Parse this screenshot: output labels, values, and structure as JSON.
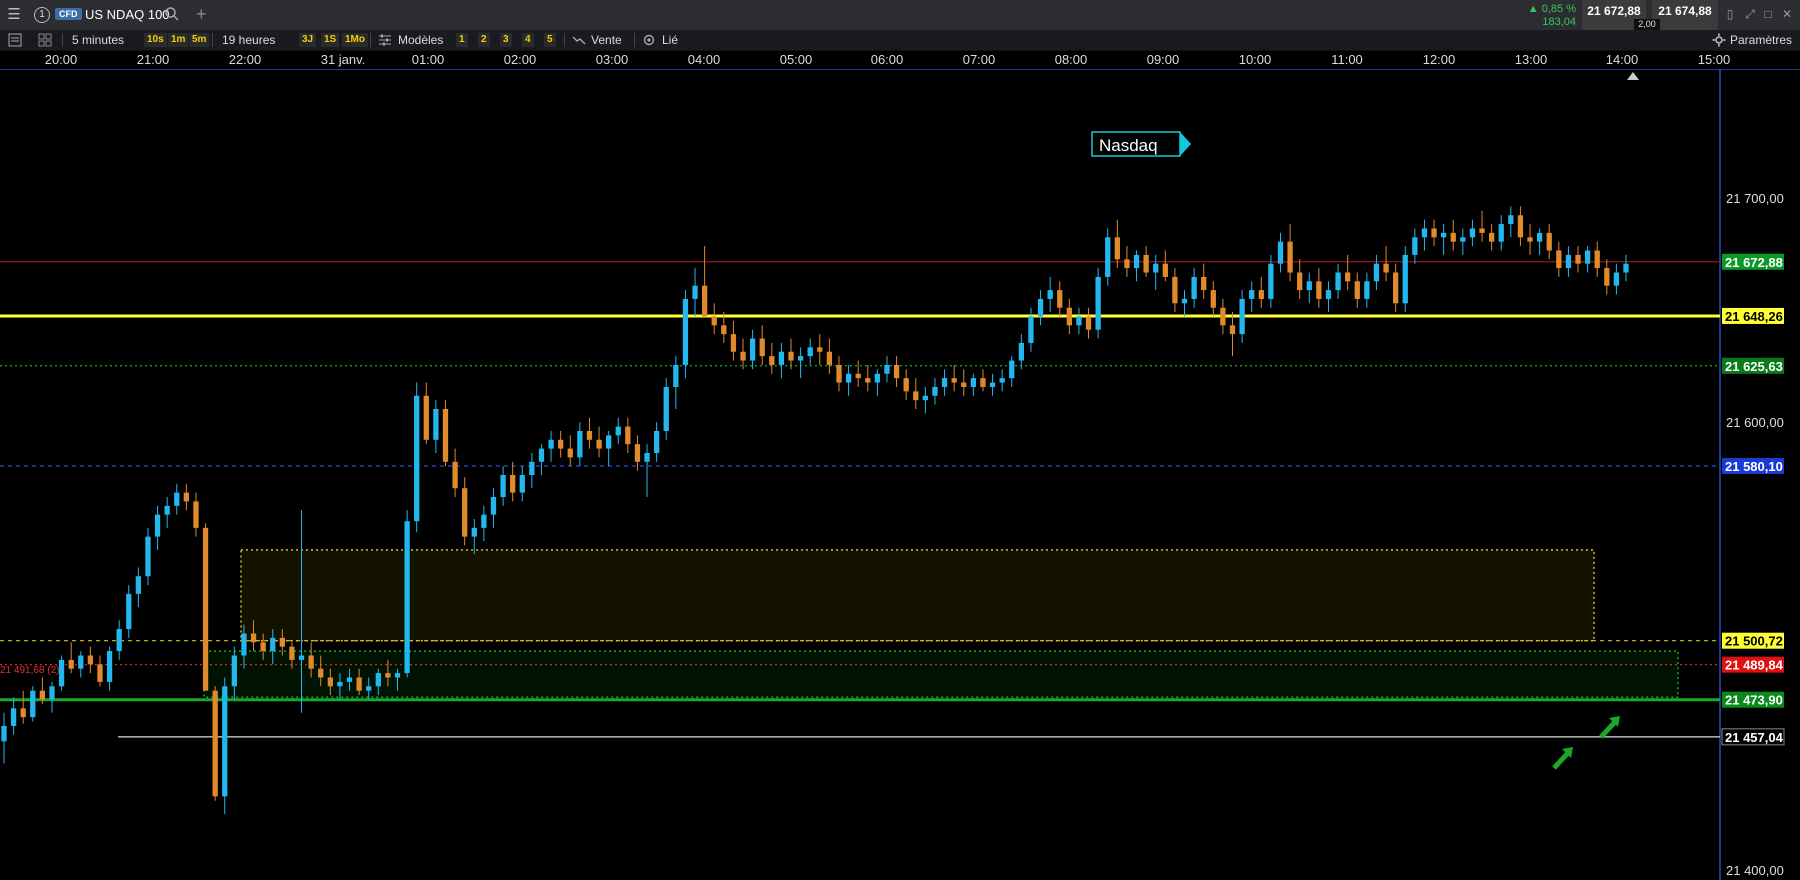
{
  "titlebar": {
    "window_number": "1",
    "instrument_type": "CFD",
    "symbol": "US NDAQ 100",
    "change_pct": "▲ 0,85 %",
    "change_abs": "183,04",
    "bid": "21 672,88",
    "spread": "2,00",
    "ask": "21 674,88"
  },
  "toolbar": {
    "interval": "5 minutes",
    "quick_intervals": [
      "10s",
      "1m",
      "5m"
    ],
    "range": "19 heures",
    "quick_ranges": [
      "3J",
      "1S",
      "1Mo"
    ],
    "models_label": "Modèles",
    "models": [
      "1",
      "2",
      "3",
      "4",
      "5"
    ],
    "sell_label": "Vente",
    "linked_label": "Lié",
    "settings_label": "Paramètres"
  },
  "time_axis": [
    "20:00",
    "21:00",
    "22:00",
    "31 janv.",
    "01:00",
    "02:00",
    "03:00",
    "04:00",
    "05:00",
    "06:00",
    "07:00",
    "08:00",
    "09:00",
    "10:00",
    "11:00",
    "12:00",
    "13:00",
    "14:00",
    "15:00"
  ],
  "annotation": {
    "text": "Nasdaq"
  },
  "price_axis": [
    "21 700,00",
    "21 600,00",
    "21 400,00"
  ],
  "levels": [
    {
      "label": "21 672,88",
      "value": 21672.88,
      "color": "#8b1a1a",
      "badge_bg": "#0a9a2a",
      "badge_fg": "#ffffff",
      "style": "solid"
    },
    {
      "label": "21 648,26",
      "value": 21648.26,
      "color": "#ffff33",
      "badge_bg": "#ffff33",
      "badge_fg": "#000000",
      "style": "solid-thick"
    },
    {
      "label": "21 625,63",
      "value": 21625.63,
      "color": "#1aaa2a",
      "badge_bg": "#0a7a1a",
      "badge_fg": "#ffffff",
      "style": "dotted"
    },
    {
      "label": "21 580,10",
      "value": 21580.1,
      "color": "#2a4ad8",
      "badge_bg": "#1a3ad8",
      "badge_fg": "#ffffff",
      "style": "dashed"
    },
    {
      "label": "21 500,72",
      "value": 21500.72,
      "color": "#d8c020",
      "badge_bg": "#ffff33",
      "badge_fg": "#000000",
      "style": "dashed"
    },
    {
      "label": "21 489,84",
      "value": 21489.84,
      "color": "#e02020",
      "badge_bg": "#e01010",
      "badge_fg": "#ffffff",
      "style": "dotted"
    },
    {
      "label": "21 473,90",
      "value": 21473.9,
      "color": "#1aa82a",
      "badge_bg": "#0a8a1a",
      "badge_fg": "#ffffff",
      "style": "solid-thick"
    },
    {
      "label": "21 457,04",
      "value": 21457.04,
      "color": "#dddddd",
      "badge_bg": "#000000",
      "badge_fg": "#ffffff",
      "style": "solid"
    }
  ],
  "left_clipped_label": "21 491,68 (2)",
  "chart_data": {
    "type": "candlestick",
    "x_ticks": [
      "20:00",
      "21:00",
      "22:00",
      "31 janv.",
      "01:00",
      "02:00",
      "03:00",
      "04:00",
      "05:00",
      "06:00",
      "07:00",
      "08:00",
      "09:00",
      "10:00",
      "11:00",
      "12:00",
      "13:00",
      "14:00",
      "15:00"
    ],
    "y_ticks": [
      21700,
      21600,
      21400
    ],
    "ylim": [
      21392,
      21760
    ],
    "colors": {
      "up": "#22b8ee",
      "down": "#e08a2c"
    },
    "candles": [
      [
        21455,
        21468,
        21445,
        21462
      ],
      [
        21462,
        21475,
        21458,
        21470
      ],
      [
        21470,
        21478,
        21463,
        21466
      ],
      [
        21466,
        21480,
        21464,
        21478
      ],
      [
        21478,
        21484,
        21472,
        21474
      ],
      [
        21474,
        21482,
        21468,
        21480
      ],
      [
        21480,
        21494,
        21478,
        21492
      ],
      [
        21492,
        21500,
        21486,
        21488
      ],
      [
        21488,
        21496,
        21484,
        21494
      ],
      [
        21494,
        21498,
        21486,
        21490
      ],
      [
        21490,
        21494,
        21480,
        21482
      ],
      [
        21482,
        21498,
        21478,
        21496
      ],
      [
        21496,
        21510,
        21492,
        21506
      ],
      [
        21506,
        21526,
        21502,
        21522
      ],
      [
        21522,
        21534,
        21516,
        21530
      ],
      [
        21530,
        21552,
        21526,
        21548
      ],
      [
        21548,
        21562,
        21542,
        21558
      ],
      [
        21558,
        21566,
        21552,
        21562
      ],
      [
        21562,
        21572,
        21558,
        21568
      ],
      [
        21568,
        21572,
        21560,
        21564
      ],
      [
        21564,
        21568,
        21548,
        21552
      ],
      [
        21552,
        21554,
        21480,
        21478
      ],
      [
        21478,
        21480,
        21428,
        21430
      ],
      [
        21430,
        21484,
        21422,
        21480
      ],
      [
        21480,
        21498,
        21474,
        21494
      ],
      [
        21494,
        21508,
        21488,
        21504
      ],
      [
        21504,
        21510,
        21496,
        21500
      ],
      [
        21500,
        21504,
        21492,
        21496
      ],
      [
        21496,
        21506,
        21490,
        21502
      ],
      [
        21502,
        21506,
        21494,
        21498
      ],
      [
        21498,
        21500,
        21488,
        21492
      ],
      [
        21492,
        21560,
        21468,
        21494
      ],
      [
        21494,
        21500,
        21484,
        21488
      ],
      [
        21488,
        21494,
        21480,
        21484
      ],
      [
        21484,
        21488,
        21476,
        21480
      ],
      [
        21480,
        21486,
        21474,
        21482
      ],
      [
        21482,
        21488,
        21478,
        21484
      ],
      [
        21484,
        21488,
        21476,
        21478
      ],
      [
        21478,
        21484,
        21474,
        21480
      ],
      [
        21480,
        21488,
        21476,
        21486
      ],
      [
        21486,
        21492,
        21480,
        21484
      ],
      [
        21484,
        21488,
        21478,
        21486
      ],
      [
        21486,
        21560,
        21484,
        21555
      ],
      [
        21555,
        21618,
        21550,
        21612
      ],
      [
        21612,
        21618,
        21590,
        21592
      ],
      [
        21592,
        21610,
        21586,
        21606
      ],
      [
        21606,
        21610,
        21580,
        21582
      ],
      [
        21582,
        21588,
        21566,
        21570
      ],
      [
        21570,
        21575,
        21544,
        21548
      ],
      [
        21548,
        21556,
        21540,
        21552
      ],
      [
        21552,
        21562,
        21546,
        21558
      ],
      [
        21558,
        21570,
        21552,
        21566
      ],
      [
        21566,
        21580,
        21562,
        21576
      ],
      [
        21576,
        21582,
        21564,
        21568
      ],
      [
        21568,
        21580,
        21564,
        21576
      ],
      [
        21576,
        21586,
        21570,
        21582
      ],
      [
        21582,
        21590,
        21576,
        21588
      ],
      [
        21588,
        21596,
        21582,
        21592
      ],
      [
        21592,
        21596,
        21584,
        21588
      ],
      [
        21588,
        21594,
        21580,
        21584
      ],
      [
        21584,
        21600,
        21580,
        21596
      ],
      [
        21596,
        21602,
        21588,
        21592
      ],
      [
        21592,
        21598,
        21584,
        21588
      ],
      [
        21588,
        21596,
        21580,
        21594
      ],
      [
        21594,
        21602,
        21590,
        21598
      ],
      [
        21598,
        21602,
        21586,
        21590
      ],
      [
        21590,
        21594,
        21578,
        21582
      ],
      [
        21582,
        21590,
        21566,
        21586
      ],
      [
        21586,
        21600,
        21582,
        21596
      ],
      [
        21596,
        21620,
        21592,
        21616
      ],
      [
        21616,
        21630,
        21606,
        21626
      ],
      [
        21626,
        21660,
        21620,
        21656
      ],
      [
        21656,
        21670,
        21648,
        21662
      ],
      [
        21662,
        21680,
        21656,
        21648
      ],
      [
        21648,
        21654,
        21640,
        21644
      ],
      [
        21644,
        21650,
        21636,
        21640
      ],
      [
        21640,
        21646,
        21628,
        21632
      ],
      [
        21632,
        21638,
        21624,
        21628
      ],
      [
        21628,
        21642,
        21624,
        21638
      ],
      [
        21638,
        21644,
        21626,
        21630
      ],
      [
        21630,
        21636,
        21622,
        21626
      ],
      [
        21626,
        21636,
        21620,
        21632
      ],
      [
        21632,
        21638,
        21624,
        21628
      ],
      [
        21628,
        21634,
        21620,
        21630
      ],
      [
        21630,
        21638,
        21626,
        21634
      ],
      [
        21634,
        21640,
        21626,
        21632
      ],
      [
        21632,
        21638,
        21622,
        21626
      ],
      [
        21626,
        21630,
        21614,
        21618
      ],
      [
        21618,
        21626,
        21612,
        21622
      ],
      [
        21622,
        21628,
        21616,
        21620
      ],
      [
        21620,
        21626,
        21614,
        21618
      ],
      [
        21618,
        21624,
        21612,
        21622
      ],
      [
        21622,
        21630,
        21618,
        21626
      ],
      [
        21626,
        21630,
        21616,
        21620
      ],
      [
        21620,
        21624,
        21610,
        21614
      ],
      [
        21614,
        21620,
        21606,
        21610
      ],
      [
        21610,
        21616,
        21604,
        21612
      ],
      [
        21612,
        21620,
        21608,
        21616
      ],
      [
        21616,
        21624,
        21612,
        21620
      ],
      [
        21620,
        21626,
        21614,
        21618
      ],
      [
        21618,
        21624,
        21612,
        21616
      ],
      [
        21616,
        21622,
        21612,
        21620
      ],
      [
        21620,
        21624,
        21614,
        21616
      ],
      [
        21616,
        21622,
        21612,
        21618
      ],
      [
        21618,
        21624,
        21614,
        21620
      ],
      [
        21620,
        21630,
        21616,
        21628
      ],
      [
        21628,
        21640,
        21624,
        21636
      ],
      [
        21636,
        21652,
        21632,
        21648
      ],
      [
        21648,
        21660,
        21644,
        21656
      ],
      [
        21656,
        21666,
        21650,
        21660
      ],
      [
        21660,
        21664,
        21648,
        21652
      ],
      [
        21652,
        21656,
        21640,
        21644
      ],
      [
        21644,
        21652,
        21640,
        21648
      ],
      [
        21648,
        21652,
        21638,
        21642
      ],
      [
        21642,
        21670,
        21638,
        21666
      ],
      [
        21666,
        21688,
        21662,
        21684
      ],
      [
        21684,
        21692,
        21670,
        21674
      ],
      [
        21674,
        21680,
        21666,
        21670
      ],
      [
        21670,
        21678,
        21664,
        21676
      ],
      [
        21676,
        21680,
        21666,
        21668
      ],
      [
        21668,
        21676,
        21660,
        21672
      ],
      [
        21672,
        21678,
        21664,
        21666
      ],
      [
        21666,
        21670,
        21650,
        21654
      ],
      [
        21654,
        21660,
        21648,
        21656
      ],
      [
        21656,
        21670,
        21652,
        21666
      ],
      [
        21666,
        21672,
        21656,
        21660
      ],
      [
        21660,
        21664,
        21648,
        21652
      ],
      [
        21652,
        21656,
        21640,
        21644
      ],
      [
        21644,
        21650,
        21630,
        21640
      ],
      [
        21640,
        21660,
        21636,
        21656
      ],
      [
        21656,
        21664,
        21650,
        21660
      ],
      [
        21660,
        21666,
        21652,
        21656
      ],
      [
        21656,
        21676,
        21652,
        21672
      ],
      [
        21672,
        21686,
        21668,
        21682
      ],
      [
        21682,
        21690,
        21664,
        21668
      ],
      [
        21668,
        21674,
        21656,
        21660
      ],
      [
        21660,
        21668,
        21654,
        21664
      ],
      [
        21664,
        21670,
        21652,
        21656
      ],
      [
        21656,
        21664,
        21650,
        21660
      ],
      [
        21660,
        21672,
        21656,
        21668
      ],
      [
        21668,
        21676,
        21660,
        21664
      ],
      [
        21664,
        21668,
        21652,
        21656
      ],
      [
        21656,
        21668,
        21652,
        21664
      ],
      [
        21664,
        21676,
        21660,
        21672
      ],
      [
        21672,
        21680,
        21664,
        21668
      ],
      [
        21668,
        21672,
        21650,
        21654
      ],
      [
        21654,
        21680,
        21650,
        21676
      ],
      [
        21676,
        21688,
        21672,
        21684
      ],
      [
        21684,
        21692,
        21678,
        21688
      ],
      [
        21688,
        21692,
        21680,
        21684
      ],
      [
        21684,
        21690,
        21676,
        21686
      ],
      [
        21686,
        21692,
        21678,
        21682
      ],
      [
        21682,
        21688,
        21676,
        21684
      ],
      [
        21684,
        21692,
        21680,
        21688
      ],
      [
        21688,
        21696,
        21682,
        21686
      ],
      [
        21686,
        21690,
        21678,
        21682
      ],
      [
        21682,
        21694,
        21678,
        21690
      ],
      [
        21690,
        21698,
        21684,
        21694
      ],
      [
        21694,
        21698,
        21680,
        21684
      ],
      [
        21684,
        21690,
        21676,
        21682
      ],
      [
        21682,
        21688,
        21676,
        21686
      ],
      [
        21686,
        21690,
        21674,
        21678
      ],
      [
        21678,
        21682,
        21666,
        21670
      ],
      [
        21670,
        21680,
        21666,
        21676
      ],
      [
        21676,
        21680,
        21668,
        21672
      ],
      [
        21672,
        21680,
        21668,
        21678
      ],
      [
        21678,
        21682,
        21666,
        21670
      ],
      [
        21670,
        21674,
        21658,
        21662
      ],
      [
        21662,
        21672,
        21658,
        21668
      ],
      [
        21668,
        21676,
        21664,
        21672
      ]
    ],
    "zones": [
      {
        "name": "yellow-zone",
        "from": 21500.72,
        "to": 21542,
        "fill": "rgba(70,60,0,0.28)",
        "stroke": "#d8c020"
      },
      {
        "name": "green-zone",
        "from": 21475,
        "to": 21496,
        "fill": "rgba(0,70,10,0.28)",
        "stroke": "#1aa82a"
      }
    ]
  }
}
